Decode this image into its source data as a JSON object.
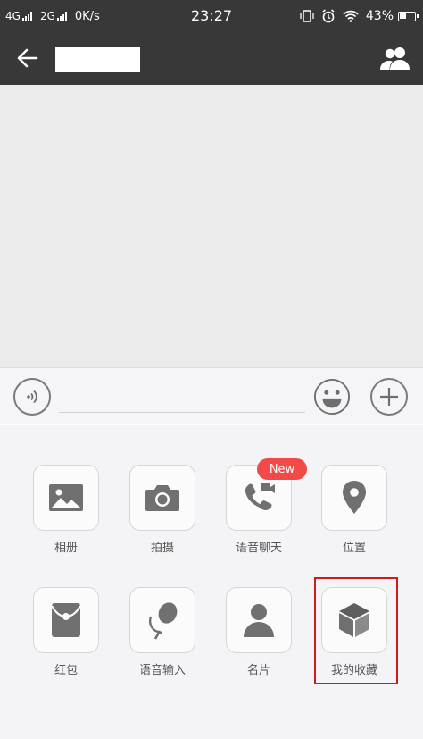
{
  "status_bar": {
    "network1": "4G",
    "network2": "2G",
    "speed": "0K/s",
    "time": "23:27",
    "battery": "43%",
    "icons": [
      "vibrate-icon",
      "alarm-icon",
      "wifi-icon",
      "battery-icon"
    ]
  },
  "header": {
    "title": "",
    "back_icon": "arrow-left-icon",
    "contact_icon": "people-icon"
  },
  "input_bar": {
    "value": "",
    "voice_icon": "voice-icon",
    "emoji_icon": "emoji-icon",
    "more_icon": "plus-icon"
  },
  "panel": {
    "items": [
      {
        "label": "相册",
        "icon": "photo-icon"
      },
      {
        "label": "拍摄",
        "icon": "camera-icon"
      },
      {
        "label": "语音聊天",
        "icon": "voice-call-icon",
        "badge": "New"
      },
      {
        "label": "位置",
        "icon": "location-icon"
      },
      {
        "label": "红包",
        "icon": "red-packet-icon"
      },
      {
        "label": "语音输入",
        "icon": "microphone-icon"
      },
      {
        "label": "名片",
        "icon": "contact-card-icon"
      },
      {
        "label": "我的收藏",
        "icon": "favorites-cube-icon"
      }
    ]
  },
  "colors": {
    "status_bar": "#383838",
    "chat_background": "#ebebeb",
    "panel_background": "#f4f4f6",
    "badge": "#f24a48",
    "highlight": "#d11b1b"
  }
}
